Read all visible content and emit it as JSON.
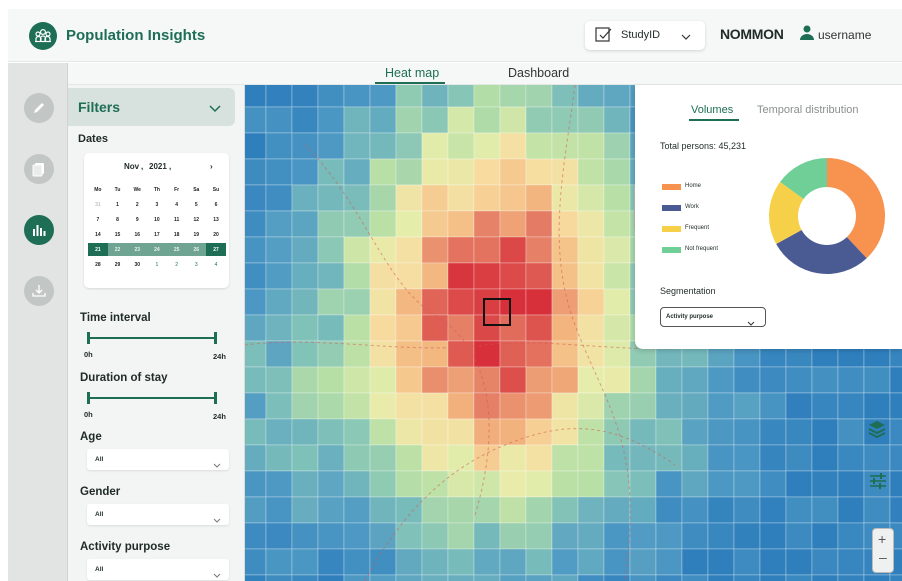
{
  "header": {
    "app_title": "Population Insights",
    "study_select": "StudyID",
    "brand": "NOMMON",
    "username": "username"
  },
  "tabs": [
    {
      "label": "Heat map",
      "active": true
    },
    {
      "label": "Dashboard",
      "active": false
    }
  ],
  "rail": {
    "items": [
      {
        "name": "pencil-icon",
        "active": false
      },
      {
        "name": "layers-doc-icon",
        "active": false
      },
      {
        "name": "bar-chart-icon",
        "active": true
      },
      {
        "name": "download-icon",
        "active": false
      }
    ]
  },
  "filters": {
    "title": "Filters",
    "dates_label": "Dates",
    "calendar": {
      "month": "Nov",
      "year": "2021",
      "dow": [
        "Mo",
        "Tu",
        "We",
        "Th",
        "Fr",
        "Sa",
        "Su"
      ],
      "days": [
        "31",
        "1",
        "2",
        "3",
        "4",
        "5",
        "6",
        "7",
        "8",
        "9",
        "10",
        "11",
        "12",
        "13",
        "14",
        "15",
        "16",
        "17",
        "18",
        "19",
        "20",
        "21",
        "22",
        "23",
        "24",
        "25",
        "26",
        "27",
        "28",
        "29",
        "30",
        "1",
        "2",
        "3",
        "4"
      ],
      "selected_range_start": "21",
      "selected_range_end": "27"
    },
    "time_interval": {
      "label": "Time interval",
      "min": "0h",
      "max": "24h"
    },
    "duration_of_stay": {
      "label": "Duration of stay",
      "min": "0h",
      "max": "24h"
    },
    "age": {
      "label": "Age",
      "value": "All"
    },
    "gender": {
      "label": "Gender",
      "value": "All"
    },
    "activity_purpose": {
      "label": "Activity purpose",
      "value": "All"
    }
  },
  "volumes_panel": {
    "tabs": [
      "Volumes",
      "Temporal distribution"
    ],
    "total_label": "Total persons: 45,231",
    "legend": [
      {
        "label": "Home",
        "color": "#f7924f"
      },
      {
        "label": "Work",
        "color": "#4a5a93"
      },
      {
        "label": "Frequent",
        "color": "#f7d04a"
      },
      {
        "label": "Not frequent",
        "color": "#6fcf97"
      }
    ],
    "segmentation_label": "Segmentation",
    "segmentation_value": "Activity purpose"
  },
  "chart_data": {
    "type": "pie",
    "categories": [
      "Home",
      "Work",
      "Frequent",
      "Not frequent"
    ],
    "values": [
      38,
      29,
      18,
      15
    ],
    "donut": true
  },
  "colors": {
    "accent": "#1d6e55",
    "heat_low": "#2f84bd",
    "heat_high": "#d7303a"
  }
}
